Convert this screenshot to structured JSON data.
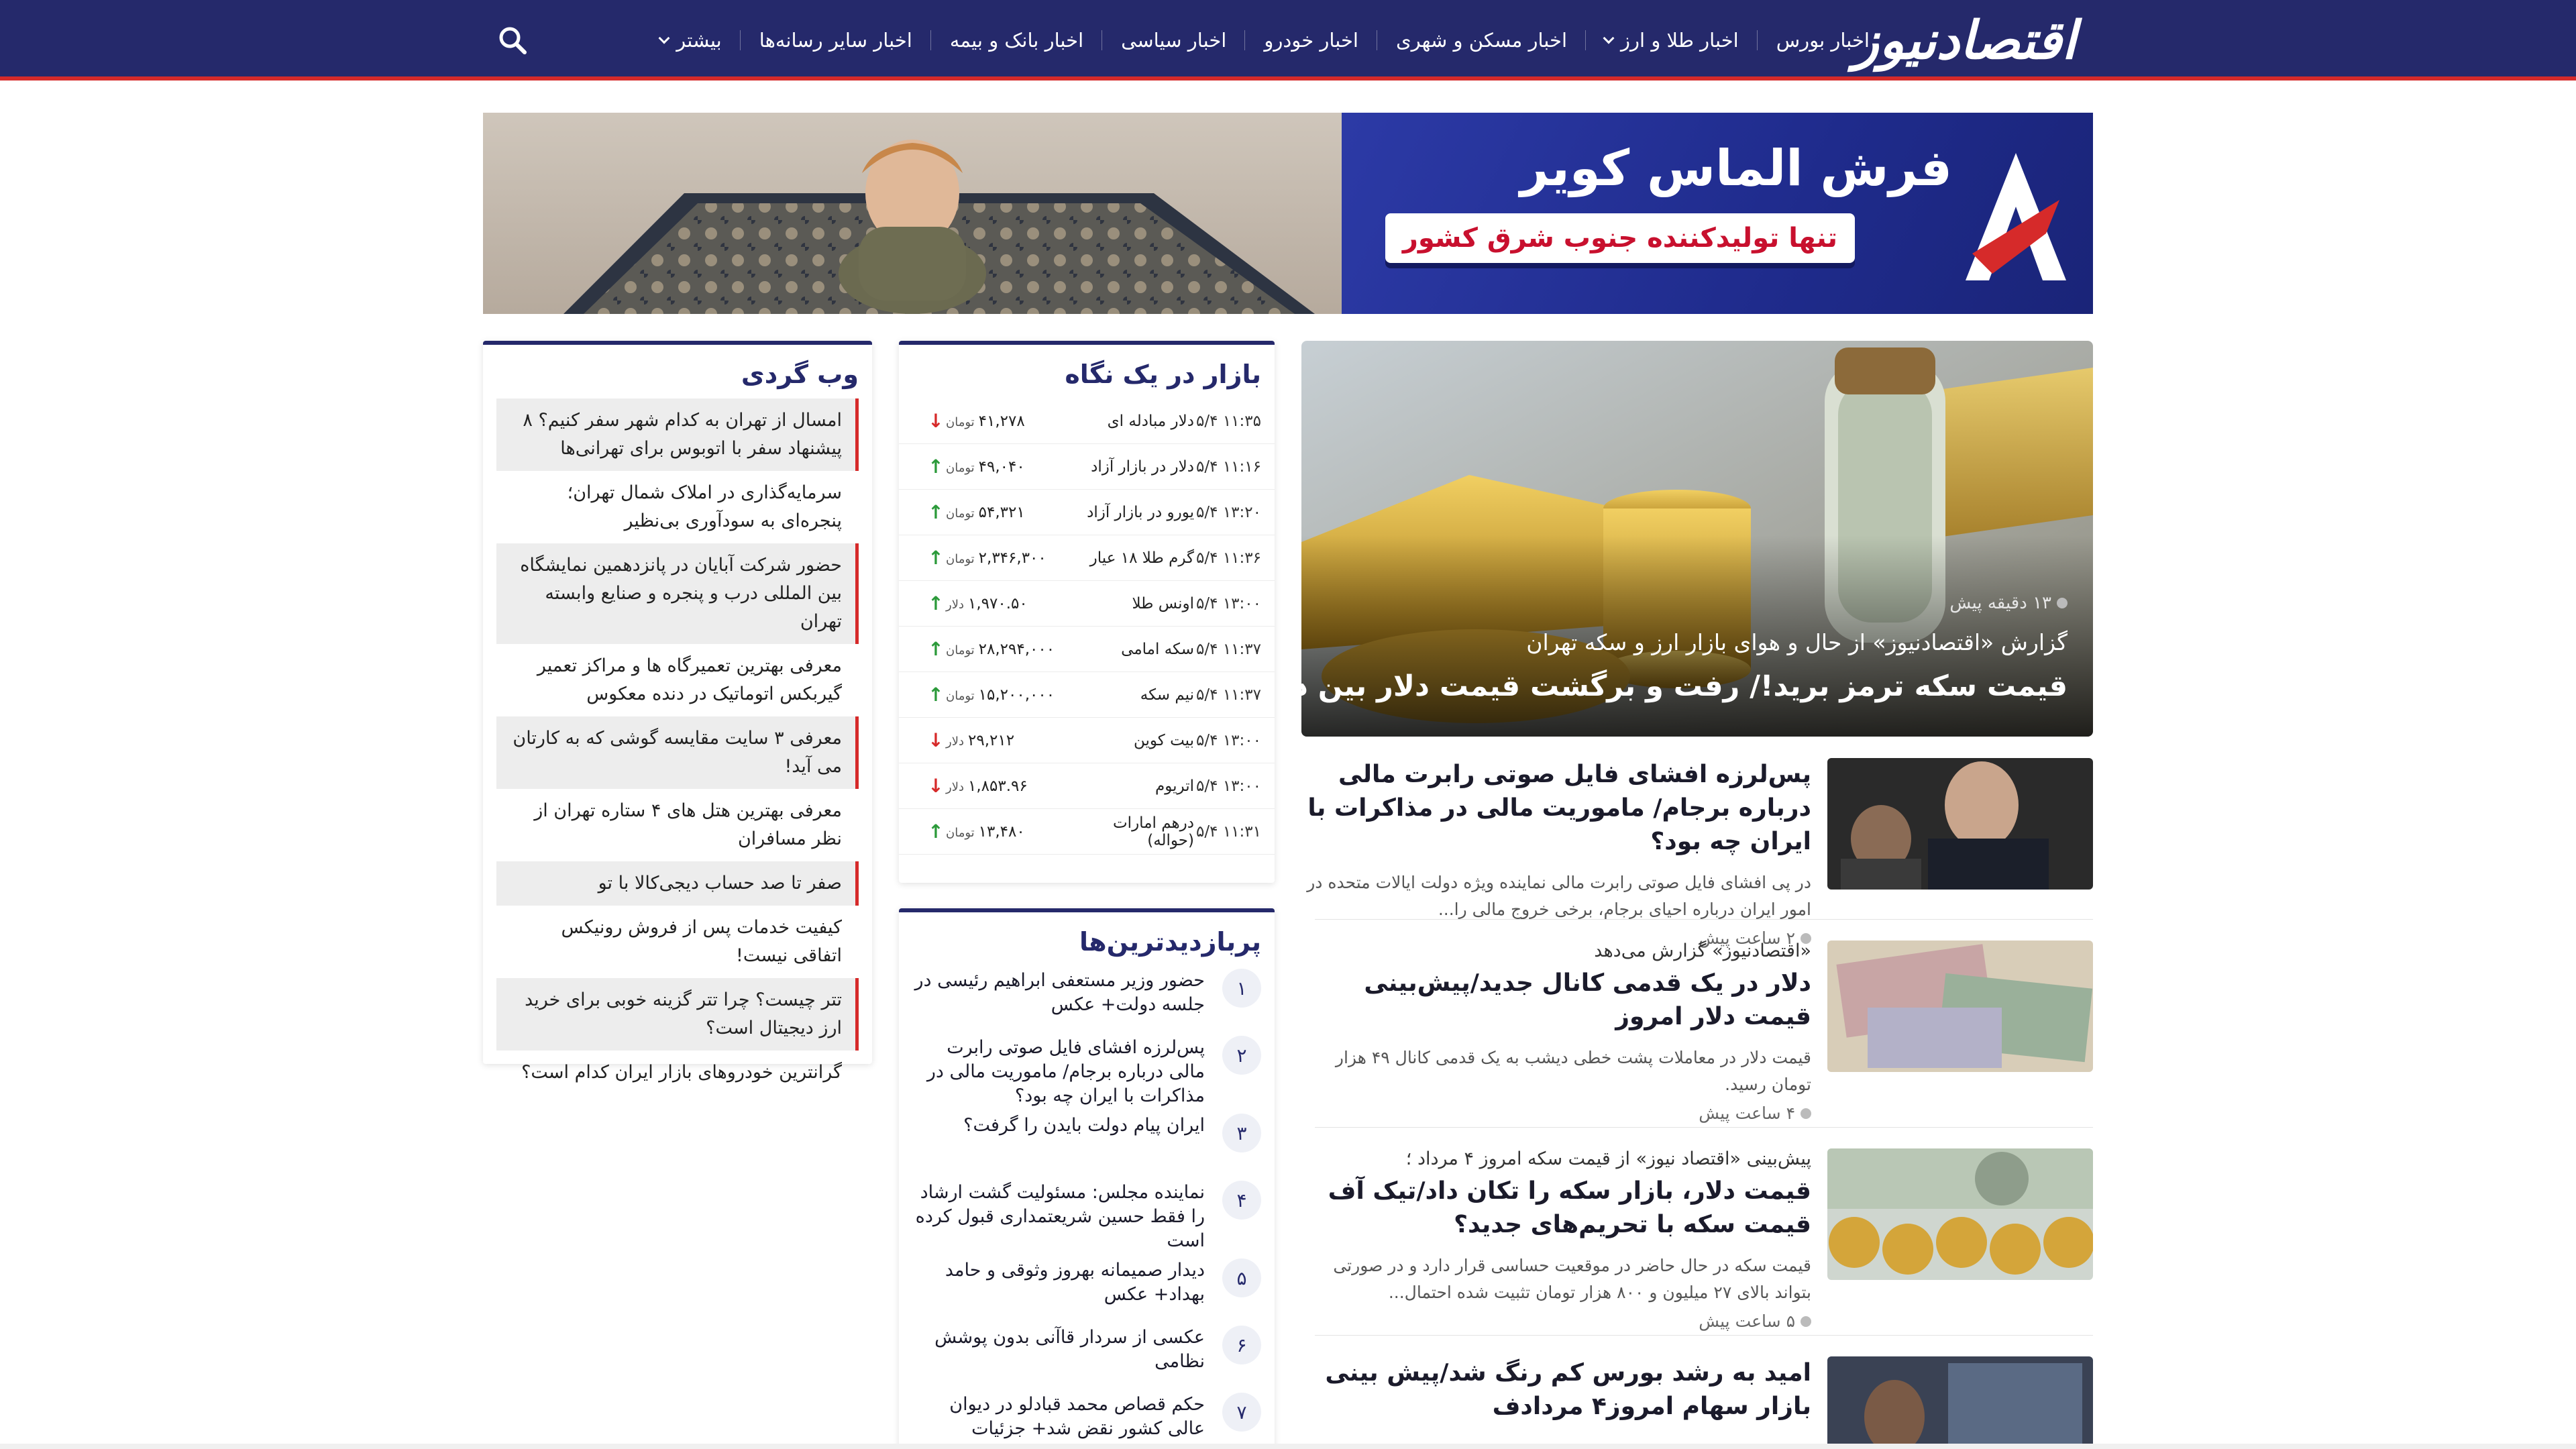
{
  "header": {
    "logo_text": "اقتصادنیوز",
    "nav": [
      {
        "label": "اخبار بورس",
        "dropdown": false
      },
      {
        "label": "اخبار طلا و ارز",
        "dropdown": true
      },
      {
        "label": "اخبار مسکن و شهری",
        "dropdown": false
      },
      {
        "label": "اخبار خودرو",
        "dropdown": false
      },
      {
        "label": "اخبار سیاسی",
        "dropdown": false
      },
      {
        "label": "اخبار بانک و بیمه",
        "dropdown": false
      },
      {
        "label": "اخبار سایر رسانه‌ها",
        "dropdown": false
      },
      {
        "label": "بیشتر",
        "dropdown": true
      }
    ],
    "search_icon": "search-icon"
  },
  "banner": {
    "title": "فرش الماس کویر",
    "subtitle": "تنها تولیدکننده جنوب شرق کشور"
  },
  "hero": {
    "time": "۱۳ دقیقه پیش",
    "kicker": "گزارش «اقتصادنیوز» از حال و هوای بازار ارز و سکه تهران",
    "title": "قیمت سکه ترمز برید!/ رفت و برگشت قیمت دلار بین دو کانال"
  },
  "news": [
    {
      "kicker": "",
      "title": "پس‌لرزه افشای فایل صوتی رابرت مالی درباره برجام/ ماموریت مالی در مذاکرات با ایران چه بود؟",
      "lead": "در پی افشای فایل صوتی رابرت مالی نماینده ویژه دولت ایالات متحده در امور ایران درباره احیای برجام، برخی خروج مالی را...",
      "time": "۲ ساعت پیش"
    },
    {
      "kicker": "«اقتصادنیوز» گزارش می‌دهد",
      "title": "دلار در یک قدمی کانال جدید/پیش‌بینی قیمت دلار امروز",
      "lead": "قیمت دلار در معاملات پشت خطی دیشب به یک قدمی کانال ۴۹ هزار تومان رسید.",
      "time": "۴ ساعت پیش"
    },
    {
      "kicker": "پیش‌بینی «اقتصاد نیوز» از قیمت سکه امروز ۴ مرداد ؛",
      "title": "قیمت دلار، بازار سکه را تکان داد/تیک آف قیمت سکه با تحریم‌های جدید؟",
      "lead": "قیمت سکه در حال حاضر در موقعیت حساسی قرار دارد و در صورتی بتواند بالای ۲۷ میلیون و ۸۰۰ هزار تومان تثبیت شده احتمال...",
      "time": "۵ ساعت پیش"
    },
    {
      "kicker": "",
      "title": "امید به رشد بورس کم رنگ شد/پیش بینی بازار سهام امروز۴ مردادف",
      "lead": "",
      "time": ""
    }
  ],
  "market": {
    "title": "بازار در یک نگاه",
    "rows": [
      {
        "time": "۱۱:۳۵ ۵/۴",
        "name": "دلار مبادله ای",
        "value": "۴۱,۲۷۸",
        "unit": "تومان",
        "trend": "down"
      },
      {
        "time": "۱۱:۱۶ ۵/۴",
        "name": "دلار در بازار آزاد",
        "value": "۴۹,۰۴۰",
        "unit": "تومان",
        "trend": "up"
      },
      {
        "time": "۱۳:۲۰ ۵/۴",
        "name": "یورو در بازار آزاد",
        "value": "۵۴,۳۲۱",
        "unit": "تومان",
        "trend": "up"
      },
      {
        "time": "۱۱:۳۶ ۵/۴",
        "name": "گرم طلا ۱۸ عیار",
        "value": "۲,۳۴۶,۳۰۰",
        "unit": "تومان",
        "trend": "up"
      },
      {
        "time": "۱۳:۰۰ ۵/۴",
        "name": "اونس طلا",
        "value": "۱,۹۷۰.۵۰",
        "unit": "دلار",
        "trend": "up"
      },
      {
        "time": "۱۱:۳۷ ۵/۴",
        "name": "سکه امامی",
        "value": "۲۸,۲۹۴,۰۰۰",
        "unit": "تومان",
        "trend": "up"
      },
      {
        "time": "۱۱:۳۷ ۵/۴",
        "name": "نیم سکه",
        "value": "۱۵,۲۰۰,۰۰۰",
        "unit": "تومان",
        "trend": "up"
      },
      {
        "time": "۱۳:۰۰ ۵/۴",
        "name": "بیت کوین",
        "value": "۲۹,۲۱۲",
        "unit": "دلار",
        "trend": "down"
      },
      {
        "time": "۱۳:۰۰ ۵/۴",
        "name": "اتریوم",
        "value": "۱,۸۵۳.۹۶",
        "unit": "دلار",
        "trend": "down"
      },
      {
        "time": "۱۱:۳۱ ۵/۴",
        "name": "درهم امارات (حواله)",
        "value": "۱۳,۴۸۰",
        "unit": "تومان",
        "trend": "up"
      }
    ]
  },
  "popular": {
    "title": "پربازدیدترین‌ها",
    "items": [
      {
        "num": "۱",
        "text": "حضور وزیر مستعفی ابراهیم رئیسی در جلسه دولت+ عکس"
      },
      {
        "num": "۲",
        "text": "پس‌لرزه افشای فایل صوتی رابرت مالی درباره برجام/ ماموریت مالی در مذاکرات با ایران چه بود؟"
      },
      {
        "num": "۳",
        "text": "ایران پیام دولت بایدن را گرفت؟"
      },
      {
        "num": "۴",
        "text": "نماینده مجلس: مسئولیت گشت ارشاد را فقط حسین شریعتمداری قبول کرده است"
      },
      {
        "num": "۵",
        "text": "دیدار صمیمانه بهروز وثوقی و حامد بهداد+ عکس"
      },
      {
        "num": "۶",
        "text": "عکسی از سردار قاآنی بدون پوشش نظامی"
      },
      {
        "num": "۷",
        "text": "حکم قصاص محمد قبادلو در دیوان عالی کشور نقض شد+ جزئیات"
      }
    ]
  },
  "web": {
    "title": "وب گردی",
    "items": [
      {
        "text": "امسال از تهران به کدام شهر سفر کنیم؟ ۸ پیشنهاد سفر با اتوبوس برای تهرانی‌ها",
        "shaded": true
      },
      {
        "text": "سرمایه‌گذاری در املاک شمال تهران؛ پنجره‌ای به سودآوری بی‌نظیر",
        "shaded": false
      },
      {
        "text": "حضور شرکت آبایان در پانزدهمین نمایشگاه بین المللی درب و پنجره و صنایع وابسته تهران",
        "shaded": true
      },
      {
        "text": "معرفی بهترین تعمیرگاه ها و مراکز تعمیر گیربکس اتوماتیک در دنده معکوس",
        "shaded": false
      },
      {
        "text": "معرفی ۳ سایت مقایسه گوشی که به کارتان می آید!",
        "shaded": true
      },
      {
        "text": "معرفی بهترین هتل های ۴ ستاره تهران از نظر مسافران",
        "shaded": false
      },
      {
        "text": "صفر تا صد حساب دیجی‌کالا با تو",
        "shaded": true
      },
      {
        "text": "کیفیت خدمات پس از فروش رونیکس اتفاقی نیست!",
        "shaded": false
      },
      {
        "text": "تتر چیست؟ چرا تتر گزینه خوبی برای خرید ارز دیجیتال است؟",
        "shaded": true
      },
      {
        "text": "گرانترین خودروهای بازار ایران کدام است؟",
        "shaded": false
      }
    ]
  },
  "colors": {
    "navy": "#25296b",
    "accent_red": "#d62a2a",
    "up_green": "#2b9a3a"
  }
}
